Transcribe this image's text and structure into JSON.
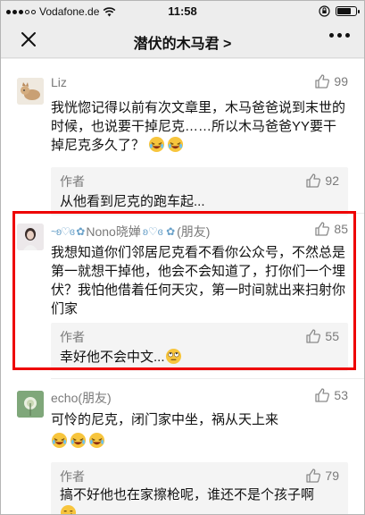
{
  "status_bar": {
    "carrier": "Vodafone.de",
    "time": "11:58"
  },
  "nav": {
    "title": "潜伏的木马君 >"
  },
  "comments": [
    {
      "name": "Liz",
      "likes": "99",
      "text": "我恍惚记得以前有次文章里，木马爸爸说到末世的时候，也说要干掉尼克……所以木马爸爸YY要干掉尼克多久了？",
      "emoji_count": 2,
      "reply": {
        "name": "作者",
        "likes": "92",
        "text": "从他看到尼克的跑车起..."
      }
    },
    {
      "name": "Nono晓婵",
      "name_suffix": "(朋友)",
      "likes": "85",
      "text": "我想知道你们邻居尼克看不看你公众号，不然总是第一就想干掉他，他会不会知道了，打你们一个埋伏？我怕他借着任何天灾，第一时间就出来扫射你们家",
      "highlighted": true,
      "reply": {
        "name": "作者",
        "likes": "55",
        "text": "幸好他不会中文..."
      }
    },
    {
      "name": "echo(朋友)",
      "likes": "53",
      "text": "可怜的尼克，闭门家中坐，祸从天上来",
      "emoji_count": 3,
      "reply": {
        "name": "作者",
        "likes": "79",
        "text": "搞不好他也在家擦枪呢，谁还不是个孩子啊"
      }
    }
  ],
  "colors": {
    "highlight_border": "#ee0000",
    "meta_text": "#7a7a7a",
    "reply_bg": "#f4f4f4"
  }
}
